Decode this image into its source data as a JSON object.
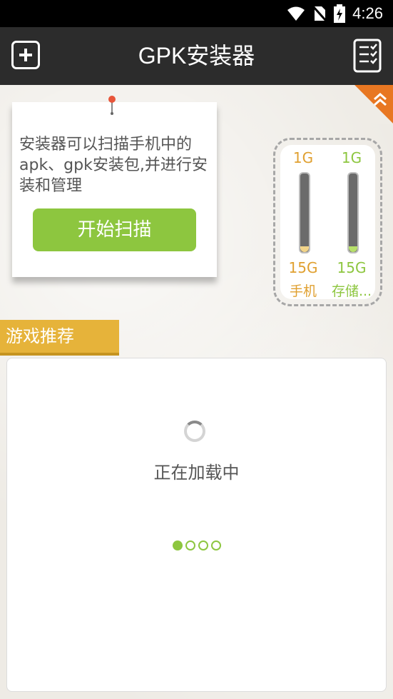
{
  "status_bar": {
    "time": "4:26",
    "icons": [
      "wifi-icon",
      "no-sim-icon",
      "battery-charging-icon"
    ]
  },
  "app_bar": {
    "title": "GPK安装器",
    "left_icon": "add-icon",
    "right_icon": "checklist-icon"
  },
  "note": {
    "text": "安装器可以扫描手机中的apk、gpk安装包,并进行安装和管理",
    "button_label": "开始扫描"
  },
  "storage": {
    "phone": {
      "used": "1G",
      "total": "15G",
      "label": "手机",
      "fill_fraction": 0.07
    },
    "sd": {
      "used": "1G",
      "total": "15G",
      "label": "存储...",
      "fill_fraction": 0.07
    }
  },
  "section": {
    "title": "游戏推荐",
    "loading_text": "正在加载中",
    "page_count": 4,
    "active_page": 1
  },
  "colors": {
    "accent_green": "#8dc63f",
    "accent_orange": "#e6b33a",
    "phone_color": "#e0a030"
  }
}
